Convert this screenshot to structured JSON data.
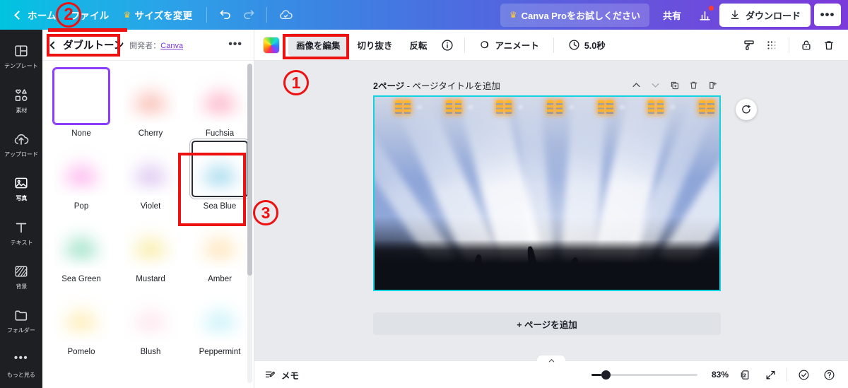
{
  "topbar": {
    "back_icon": "chevron-left-icon",
    "home_label": "ホーム",
    "file_label": "ファイル",
    "resize_label": "サイズを変更",
    "resize_icon": "crown-icon",
    "undo_icon": "undo-icon",
    "redo_icon": "redo-icon",
    "cloud_icon": "cloud-sync-icon",
    "pro_label": "Canva Proをお試しください",
    "pro_icon": "crown-icon",
    "share_label": "共有",
    "insights_icon": "bar-chart-icon",
    "download_label": "ダウンロード",
    "download_icon": "download-icon",
    "more_label": "•••"
  },
  "sidebar": {
    "items": [
      {
        "label": "テンプレート",
        "icon": "template-icon",
        "active": false
      },
      {
        "label": "素材",
        "icon": "elements-icon",
        "active": false
      },
      {
        "label": "アップロード",
        "icon": "upload-cloud-icon",
        "active": false
      },
      {
        "label": "写真",
        "icon": "photo-icon",
        "active": true
      },
      {
        "label": "テキスト",
        "icon": "text-icon",
        "active": false
      },
      {
        "label": "背景",
        "icon": "background-icon",
        "active": false
      },
      {
        "label": "フォルダー",
        "icon": "folder-icon",
        "active": false
      },
      {
        "label": "もっと見る",
        "icon": "more-dots-icon",
        "active": false
      }
    ]
  },
  "panel": {
    "back_icon": "chevron-left-icon",
    "title": "ダブルトーン",
    "developer_prefix": "開発者：",
    "developer_name": "Canva",
    "more_label": "•••",
    "presets": [
      {
        "name": "None",
        "selected": "purple",
        "top": "#cfd6e6",
        "bottom": "#0d0f16",
        "beam": "#ffffff",
        "tint": "#8fa6d8"
      },
      {
        "name": "Cherry",
        "selected": "none",
        "top": "#e04a3a",
        "bottom": "#3b2160",
        "beam": "#f4705c",
        "tint": "#d4453d"
      },
      {
        "name": "Fuchsia",
        "selected": "none",
        "top": "#ee2f6b",
        "bottom": "#182a63",
        "beam": "#fa5d8c",
        "tint": "#e62c65"
      },
      {
        "name": "Pop",
        "selected": "none",
        "top": "#e635c8",
        "bottom": "#2b1fa8",
        "beam": "#fb63dc",
        "tint": "#db33bd"
      },
      {
        "name": "Violet",
        "selected": "none",
        "top": "#9a5ad4",
        "bottom": "#3b2f6b",
        "beam": "#b383e2",
        "tint": "#8e57c9"
      },
      {
        "name": "Sea Blue",
        "selected": "dark",
        "top": "#1b8ec4",
        "bottom": "#112a52",
        "beam": "#3fb0de",
        "tint": "#1a84bb"
      },
      {
        "name": "Sea Green",
        "selected": "none",
        "top": "#119a66",
        "bottom": "#2b1f63",
        "beam": "#2fc08a",
        "tint": "#0f8f60"
      },
      {
        "name": "Mustard",
        "selected": "none",
        "top": "#e0bb1b",
        "bottom": "#2e2047",
        "beam": "#f2d845",
        "tint": "#d4b017"
      },
      {
        "name": "Amber",
        "selected": "none",
        "top": "#ffab2e",
        "bottom": "#ff4a22",
        "beam": "#ffc86a",
        "tint": "#ff9e27"
      },
      {
        "name": "Pomelo",
        "selected": "none",
        "top": "#ffc21e",
        "bottom": "#f5377f",
        "beam": "#ffd862",
        "tint": "#ffb81c"
      },
      {
        "name": "Blush",
        "selected": "none",
        "top": "#f9a8c4",
        "bottom": "#ee3a7e",
        "beam": "#fdc9dc",
        "tint": "#f79ebd"
      },
      {
        "name": "Peppermint",
        "selected": "none",
        "top": "#4fd0e8",
        "bottom": "#3a2359",
        "beam": "#8be4f3",
        "tint": "#48c4dd"
      }
    ]
  },
  "toolbar": {
    "color_swatch_icon": "rainbow-color-icon",
    "edit_image_label": "画像を編集",
    "crop_label": "切り抜き",
    "flip_label": "反転",
    "info_icon": "info-circle-icon",
    "animate_label": "アニメート",
    "animate_icon": "animate-icon",
    "duration_label": "5.0秒",
    "duration_icon": "clock-icon",
    "paint_icon": "paint-roller-icon",
    "transparency_icon": "transparency-icon",
    "lock_icon": "lock-icon",
    "delete_icon": "trash-icon"
  },
  "canvas": {
    "page_number_label": "2ページ",
    "page_title_placeholder": "- ページタイトルを追加",
    "move_up_icon": "chevron-up-icon",
    "move_down_icon": "chevron-down-icon",
    "duplicate_icon": "duplicate-page-icon",
    "delete_icon": "trash-icon",
    "add_page_icon": "add-page-icon",
    "rotate_icon": "add-comment-icon",
    "add_page_label": "+ ページを追加",
    "artboard_border_color": "#12d4e0"
  },
  "bottombar": {
    "collapse_icon": "chevron-up-icon",
    "notes_label": "メモ",
    "notes_icon": "notes-icon",
    "zoom_value": "83%",
    "page_count": "2",
    "pages_icon": "pages-icon",
    "fullscreen_icon": "expand-icon",
    "check_icon": "check-circle-icon",
    "help_icon": "help-circle-icon"
  },
  "annotations": [
    {
      "label": "1",
      "kind": "circle"
    },
    {
      "label": "2",
      "kind": "circle"
    },
    {
      "label": "3",
      "kind": "circle"
    }
  ],
  "colors": {
    "annotation_red": "#ee1111",
    "brand_purple": "#8b3dff",
    "selection_cyan": "#12d4e0"
  }
}
